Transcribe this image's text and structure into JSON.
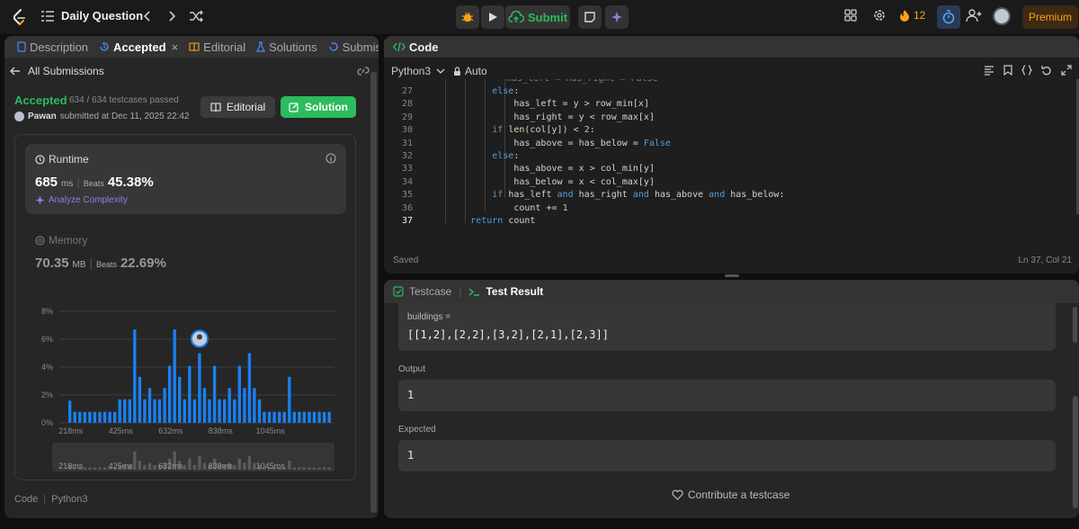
{
  "topbar": {
    "title": "Daily Question",
    "submit_label": "Submit",
    "streak_count": "12",
    "premium_label": "Premium"
  },
  "left_tabs": [
    "Description",
    "Accepted",
    "Editorial",
    "Solutions",
    "Submissions"
  ],
  "all_submissions_label": "All Submissions",
  "result": {
    "status": "Accepted",
    "passed_text": "634 / 634 testcases passed",
    "user": "Pawan",
    "submitted_text": "submitted at Dec 11, 2025 22:42",
    "editorial_btn": "Editorial",
    "solution_btn": "Solution"
  },
  "runtime": {
    "title": "Runtime",
    "value": "685",
    "unit": "ms",
    "beats_label": "Beats",
    "beats": "45.38%",
    "analyze_label": "Analyze Complexity"
  },
  "memory": {
    "title": "Memory",
    "value": "70.35",
    "unit": "MB",
    "beats_label": "Beats",
    "beats": "22.69%"
  },
  "chart_data": {
    "type": "bar",
    "y_tick_labels": [
      "8%",
      "6%",
      "4%",
      "2%",
      "0%"
    ],
    "x_tick_labels": [
      "218ms",
      "425ms",
      "632ms",
      "838ms",
      "1045ms"
    ],
    "ylim": [
      0,
      8
    ],
    "values": [
      1.6,
      0.8,
      0.8,
      0.8,
      0.8,
      0.8,
      0.8,
      0.8,
      0.8,
      0.8,
      1.7,
      1.7,
      1.7,
      6.7,
      3.3,
      1.7,
      2.5,
      1.7,
      1.7,
      2.5,
      4.1,
      6.7,
      3.3,
      1.7,
      4.1,
      1.7,
      5.0,
      2.5,
      1.7,
      4.1,
      1.7,
      1.7,
      2.5,
      1.7,
      4.1,
      2.5,
      5.0,
      2.5,
      1.7,
      0.8,
      0.8,
      0.8,
      0.8,
      0.8,
      3.3,
      0.8,
      0.8,
      0.8,
      0.8,
      0.8,
      0.8,
      0.8,
      0.8
    ],
    "highlight_index": 26,
    "bar_color": "#1a7ff0",
    "grid": true
  },
  "code_footer": {
    "label": "Code",
    "lang": "Python3"
  },
  "editor": {
    "header": "Code",
    "language": "Python3",
    "mode": "Auto",
    "status": "Saved",
    "cursor": "Ln 37, Col 21",
    "lines": [
      {
        "n": "27",
        "text": "            else:"
      },
      {
        "n": "28",
        "text": "                has_left = y > row_min[x]"
      },
      {
        "n": "29",
        "text": "                has_right = y < row_max[x]"
      },
      {
        "n": "30",
        "text": "            if len(col[y]) < 2:"
      },
      {
        "n": "31",
        "text": "                has_above = has_below = False"
      },
      {
        "n": "32",
        "text": "            else:"
      },
      {
        "n": "33",
        "text": "                has_above = x > col_min[y]"
      },
      {
        "n": "34",
        "text": "                has_below = x < col_max[y]"
      },
      {
        "n": "35",
        "text": "            if has_left and has_right and has_above and has_below:"
      },
      {
        "n": "36",
        "text": "                count += 1"
      },
      {
        "n": "37",
        "text": "        return count"
      }
    ]
  },
  "tests": {
    "tab_testcase": "Testcase",
    "tab_result": "Test Result",
    "input_label": "buildings =",
    "input_value": "[[1,2],[2,2],[3,2],[2,1],[2,3]]",
    "output_label": "Output",
    "output_value": "1",
    "expected_label": "Expected",
    "expected_value": "1",
    "contribute_label": "Contribute a testcase"
  }
}
